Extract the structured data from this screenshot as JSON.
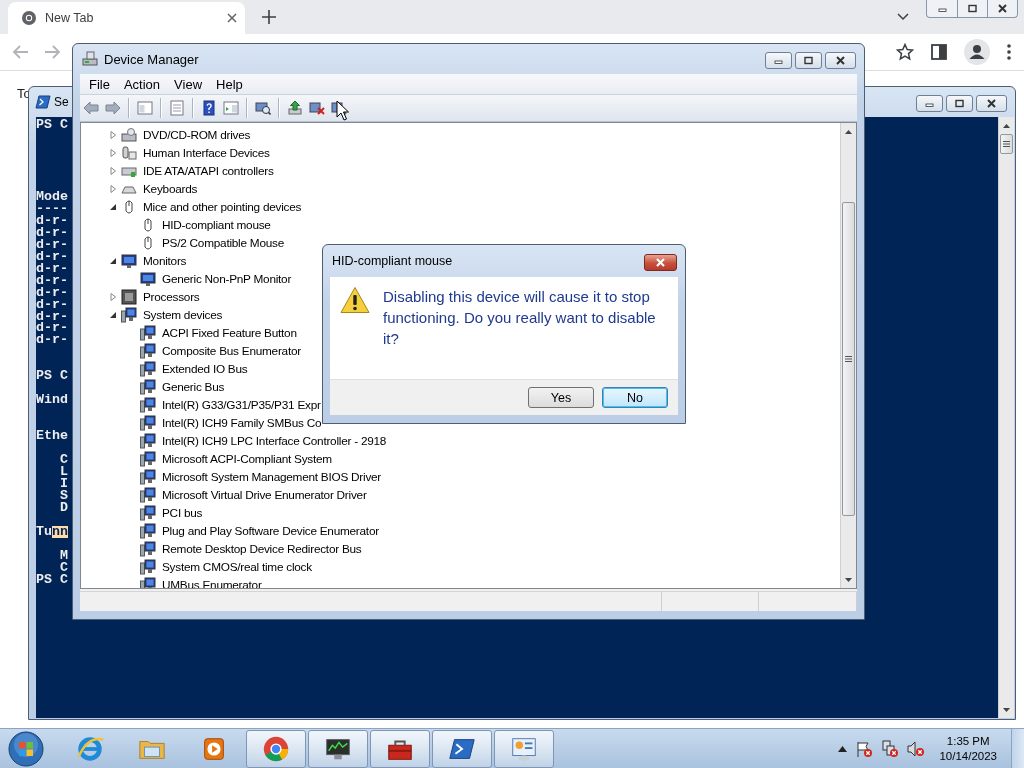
{
  "browser": {
    "tabs": [
      {
        "label": "New Tab",
        "selected": true
      }
    ],
    "page_text": "To"
  },
  "powershell": {
    "title": "Se",
    "lines": [
      {
        "text": "PS C"
      },
      {
        "kind": "blank"
      },
      {
        "kind": "blank"
      },
      {
        "kind": "blank"
      },
      {
        "kind": "blank"
      },
      {
        "kind": "blank"
      },
      {
        "text": "Mode"
      },
      {
        "text": "----"
      },
      {
        "text": "d-r-"
      },
      {
        "text": "d-r-"
      },
      {
        "text": "d-r-"
      },
      {
        "text": "d-r-"
      },
      {
        "text": "d-r-"
      },
      {
        "text": "d-r-"
      },
      {
        "text": "d-r-"
      },
      {
        "text": "d-r-"
      },
      {
        "text": "d-r-"
      },
      {
        "text": "d-r-"
      },
      {
        "text": "d-r-"
      },
      {
        "kind": "blank"
      },
      {
        "kind": "blank"
      },
      {
        "text": "PS C"
      },
      {
        "kind": "blank"
      },
      {
        "text": "Wind"
      },
      {
        "kind": "blank"
      },
      {
        "kind": "blank"
      },
      {
        "text": "Ethe"
      },
      {
        "kind": "blank"
      },
      {
        "text": "   C"
      },
      {
        "text": "   L"
      },
      {
        "text": "   I"
      },
      {
        "text": "   S"
      },
      {
        "text": "   D"
      },
      {
        "kind": "blank"
      },
      {
        "text": "Tu",
        "selected_text": "nn"
      },
      {
        "kind": "blank"
      },
      {
        "text": "   M"
      },
      {
        "text": "   C"
      },
      {
        "text": "PS C"
      }
    ]
  },
  "device_manager": {
    "title": "Device Manager",
    "menu": [
      "File",
      "Action",
      "View",
      "Help"
    ],
    "toolbar": [
      {
        "kind": "back"
      },
      {
        "kind": "forward"
      },
      {
        "kind": "separator"
      },
      {
        "kind": "console_tree"
      },
      {
        "kind": "separator"
      },
      {
        "kind": "properties"
      },
      {
        "kind": "separator"
      },
      {
        "kind": "help"
      },
      {
        "kind": "action_pane"
      },
      {
        "kind": "separator"
      },
      {
        "kind": "scan"
      },
      {
        "kind": "separator"
      },
      {
        "kind": "update_driver"
      },
      {
        "kind": "uninstall"
      },
      {
        "kind": "disable"
      }
    ],
    "tree": [
      {
        "label": "DVD/CD-ROM drives",
        "kind": "dvd",
        "expanded": false
      },
      {
        "label": "Human Interface Devices",
        "kind": "hid",
        "expanded": false
      },
      {
        "label": "IDE ATA/ATAPI controllers",
        "kind": "ide",
        "expanded": false
      },
      {
        "label": "Keyboards",
        "kind": "keyboard",
        "expanded": false
      },
      {
        "label": "Mice and other pointing devices",
        "kind": "mouse",
        "expanded": true,
        "children": [
          {
            "label": "HID-compliant mouse",
            "kind": "mouse"
          },
          {
            "label": "PS/2 Compatible Mouse",
            "kind": "mouse"
          }
        ]
      },
      {
        "label": "Monitors",
        "kind": "monitor",
        "expanded": true,
        "children": [
          {
            "label": "Generic Non-PnP Monitor",
            "kind": "monitor"
          }
        ]
      },
      {
        "label": "Processors",
        "kind": "processor",
        "expanded": false
      },
      {
        "label": "System devices",
        "kind": "system",
        "expanded": true,
        "children": [
          {
            "label": "ACPI Fixed Feature Button",
            "kind": "system"
          },
          {
            "label": "Composite Bus Enumerator",
            "kind": "system"
          },
          {
            "label": "Extended IO Bus",
            "kind": "system"
          },
          {
            "label": "Generic Bus",
            "kind": "system"
          },
          {
            "label": "Intel(R) G33/G31/P35/P31 Expr",
            "kind": "system"
          },
          {
            "label": "Intel(R) ICH9 Family SMBus Co",
            "kind": "system"
          },
          {
            "label": "Intel(R) ICH9 LPC Interface Controller - 2918",
            "kind": "system"
          },
          {
            "label": "Microsoft ACPI-Compliant System",
            "kind": "system"
          },
          {
            "label": "Microsoft System Management BIOS Driver",
            "kind": "system"
          },
          {
            "label": "Microsoft Virtual Drive Enumerator Driver",
            "kind": "system"
          },
          {
            "label": "PCI bus",
            "kind": "system"
          },
          {
            "label": "Plug and Play Software Device Enumerator",
            "kind": "system"
          },
          {
            "label": "Remote Desktop Device Redirector Bus",
            "kind": "system"
          },
          {
            "label": "System CMOS/real time clock",
            "kind": "system"
          },
          {
            "label": "UMBus Enumerator",
            "kind": "system"
          }
        ]
      }
    ]
  },
  "dialog": {
    "title": "HID-compliant mouse",
    "message": "Disabling this device will cause it to stop functioning. Do you really want to disable it?",
    "buttons": [
      {
        "label": "Yes",
        "default": false
      },
      {
        "label": "No",
        "default": true
      }
    ]
  },
  "taskbar": {
    "items": [
      {
        "kind": "ie",
        "running": false
      },
      {
        "kind": "explorer",
        "running": false
      },
      {
        "kind": "media",
        "running": false
      },
      {
        "kind": "chrome",
        "running": true
      },
      {
        "kind": "monitor_app",
        "running": true
      },
      {
        "kind": "toolbox",
        "running": true
      },
      {
        "kind": "powershell",
        "running": true
      },
      {
        "kind": "control_panel",
        "running": true
      }
    ],
    "time": "1:35 PM",
    "date": "10/14/2023"
  }
}
